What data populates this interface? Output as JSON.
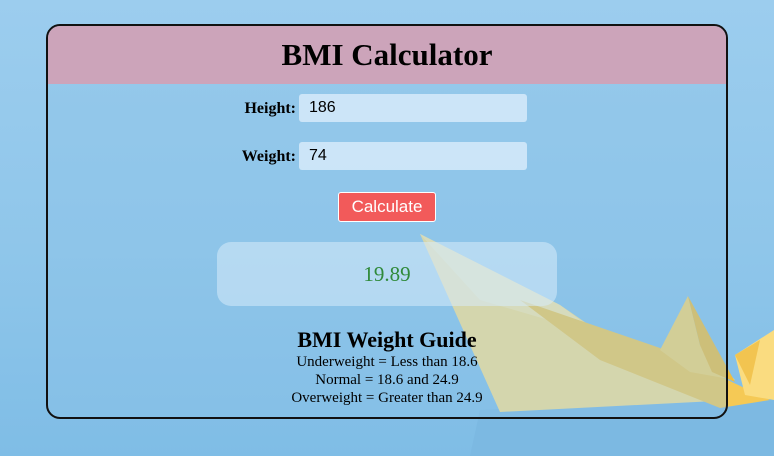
{
  "app": {
    "title": "BMI Calculator"
  },
  "form": {
    "height_label": "Height:",
    "height_value": "186",
    "weight_label": "Weight:",
    "weight_value": "74",
    "calculate_label": "Calculate"
  },
  "result": {
    "value": "19.89",
    "color": "#2f8a3a"
  },
  "guide": {
    "title": "BMI Weight Guide",
    "lines": [
      "Underweight = Less than 18.6",
      "Normal = 18.6 and 24.9",
      "Overweight = Greater than 24.9"
    ]
  },
  "colors": {
    "header_bg": "#d69eb2",
    "button_bg": "#f25a5a",
    "background": "#8fc6ea",
    "boat": "#f9d46a"
  }
}
